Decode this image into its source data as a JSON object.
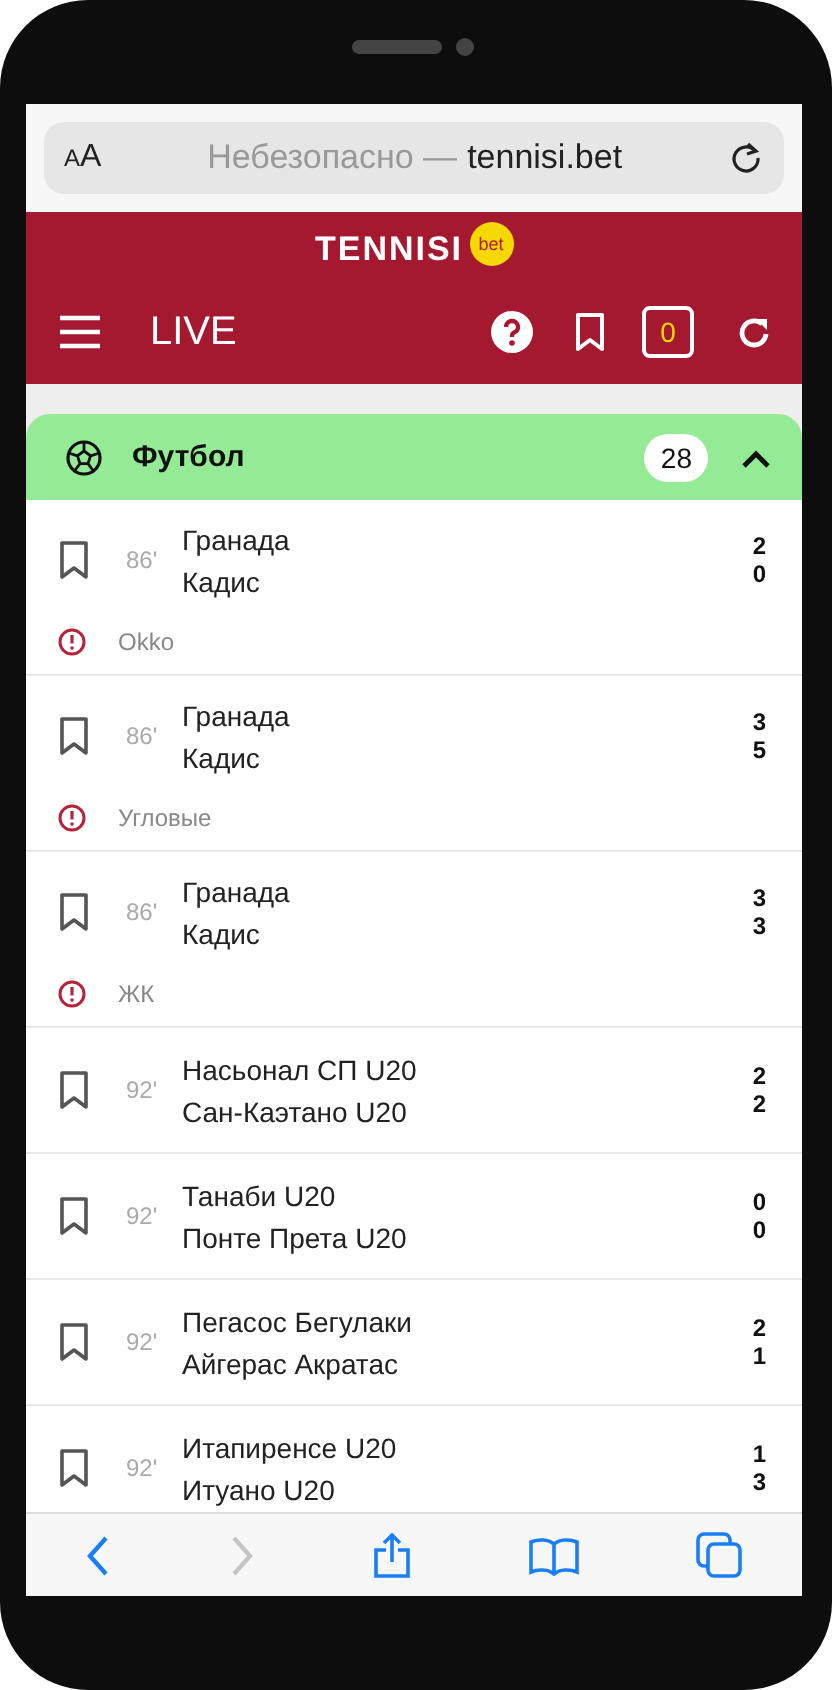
{
  "browser": {
    "text_size_button": "AA",
    "security_label": "Небезопасно —",
    "domain": "tennisi.bet"
  },
  "header": {
    "logo": "TENNISI",
    "logo_badge": "bet",
    "title": "LIVE",
    "betslip_count": "0"
  },
  "section": {
    "name": "Футбол",
    "count": "28",
    "expanded": true
  },
  "matches": [
    {
      "minute": "86'",
      "team_1": "Гранада",
      "team_2": "Кадис",
      "score_1": "2",
      "score_2": "0",
      "note": "Okko"
    },
    {
      "minute": "86'",
      "team_1": "Гранада",
      "team_2": "Кадис",
      "score_1": "3",
      "score_2": "5",
      "note": "Угловые"
    },
    {
      "minute": "86'",
      "team_1": "Гранада",
      "team_2": "Кадис",
      "score_1": "3",
      "score_2": "3",
      "note": "ЖК"
    },
    {
      "minute": "92'",
      "team_1": "Насьонал СП U20",
      "team_2": "Сан-Каэтано U20",
      "score_1": "2",
      "score_2": "2"
    },
    {
      "minute": "92'",
      "team_1": "Танаби U20",
      "team_2": "Понте Прета U20",
      "score_1": "0",
      "score_2": "0"
    },
    {
      "minute": "92'",
      "team_1": "Пегасос Бегулаки",
      "team_2": "Айгерас Акратас",
      "score_1": "2",
      "score_2": "1"
    },
    {
      "minute": "92'",
      "team_1": "Итапиренсе U20",
      "team_2": "Итуано U20",
      "score_1": "1",
      "score_2": "3"
    }
  ],
  "toolbar": [
    {
      "kind": "back",
      "disabled": false
    },
    {
      "kind": "forward",
      "disabled": true
    },
    {
      "kind": "share",
      "disabled": false
    },
    {
      "kind": "bookmarks",
      "disabled": false
    },
    {
      "kind": "tabs",
      "disabled": false
    }
  ]
}
